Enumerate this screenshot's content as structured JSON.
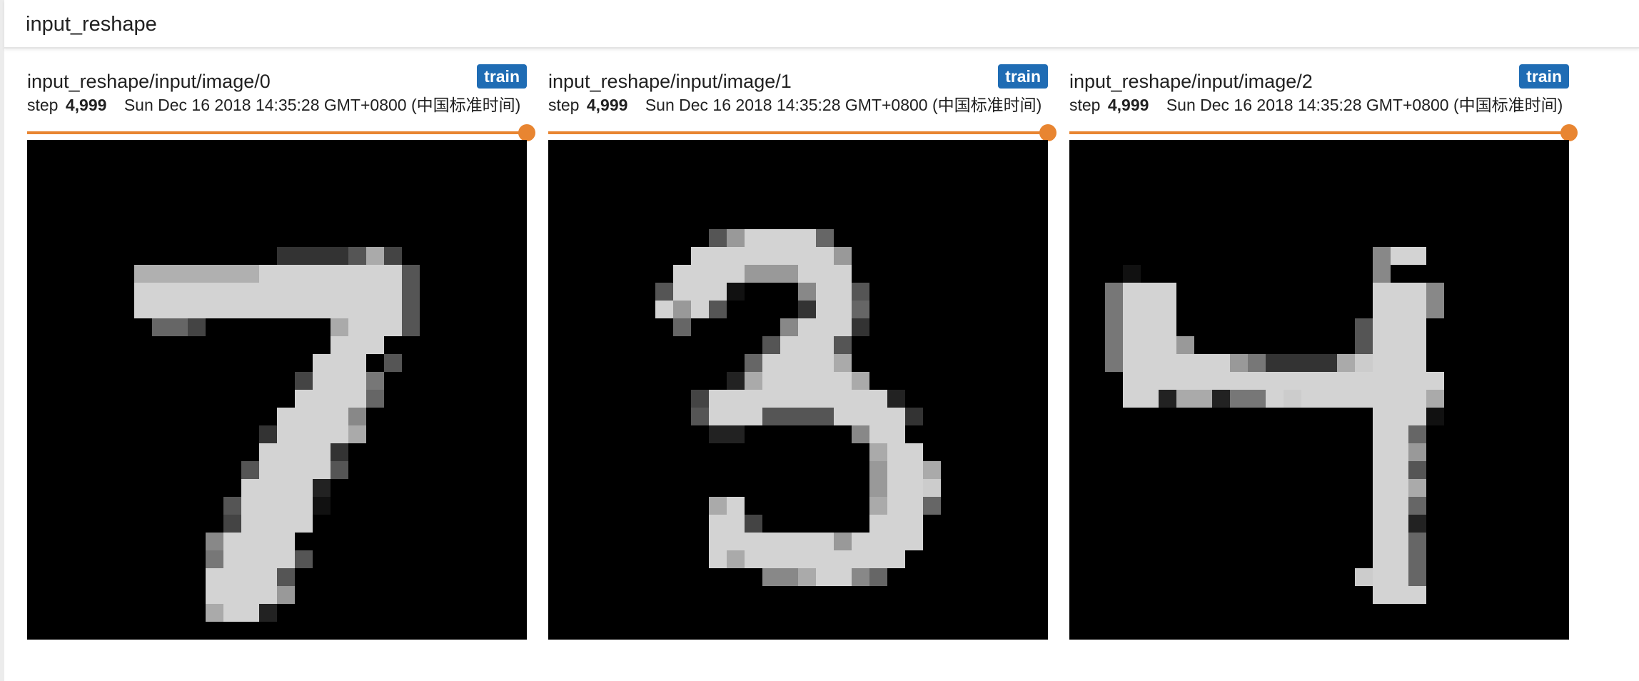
{
  "section": {
    "title": "input_reshape"
  },
  "cards": [
    {
      "title": "input_reshape/input/image/0",
      "run": "train",
      "step_label": "step",
      "step_value": "4,999",
      "timestamp": "Sun Dec 16 2018 14:35:28 GMT+0800 (中国标准时间)",
      "slider_position": 1.0,
      "digit": "7"
    },
    {
      "title": "input_reshape/input/image/1",
      "run": "train",
      "step_label": "step",
      "step_value": "4,999",
      "timestamp": "Sun Dec 16 2018 14:35:28 GMT+0800 (中国标准时间)",
      "slider_position": 1.0,
      "digit": "3"
    },
    {
      "title": "input_reshape/input/image/2",
      "run": "train",
      "step_label": "step",
      "step_value": "4,999",
      "timestamp": "Sun Dec 16 2018 14:35:28 GMT+0800 (中国标准时间)",
      "slider_position": 1.0,
      "digit": "4"
    }
  ],
  "colors": {
    "run_badge": "#1f6cb4",
    "slider": "#e88531",
    "image_background": "#000000",
    "stroke": "#d3d3d3"
  }
}
